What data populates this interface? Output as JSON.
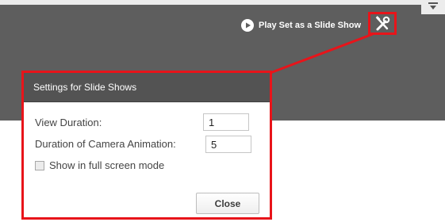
{
  "toolbar": {
    "play_label": "Play Set as a Slide Show",
    "play_icon": "play-circle-icon",
    "settings_icon": "tools-icon",
    "menu_icon": "chevron-down-icon"
  },
  "dialog": {
    "title": "Settings for Slide Shows",
    "view_duration_label": "View Duration:",
    "view_duration_value": "1",
    "camera_animation_label": "Duration of Camera Animation:",
    "camera_animation_value": "5",
    "fullscreen_label": "Show in full screen mode",
    "fullscreen_checked": false,
    "close_label": "Close"
  },
  "colors": {
    "highlight": "#e8141a",
    "toolbar_bg": "#5e5e5e",
    "dialog_header_bg": "#535353"
  }
}
